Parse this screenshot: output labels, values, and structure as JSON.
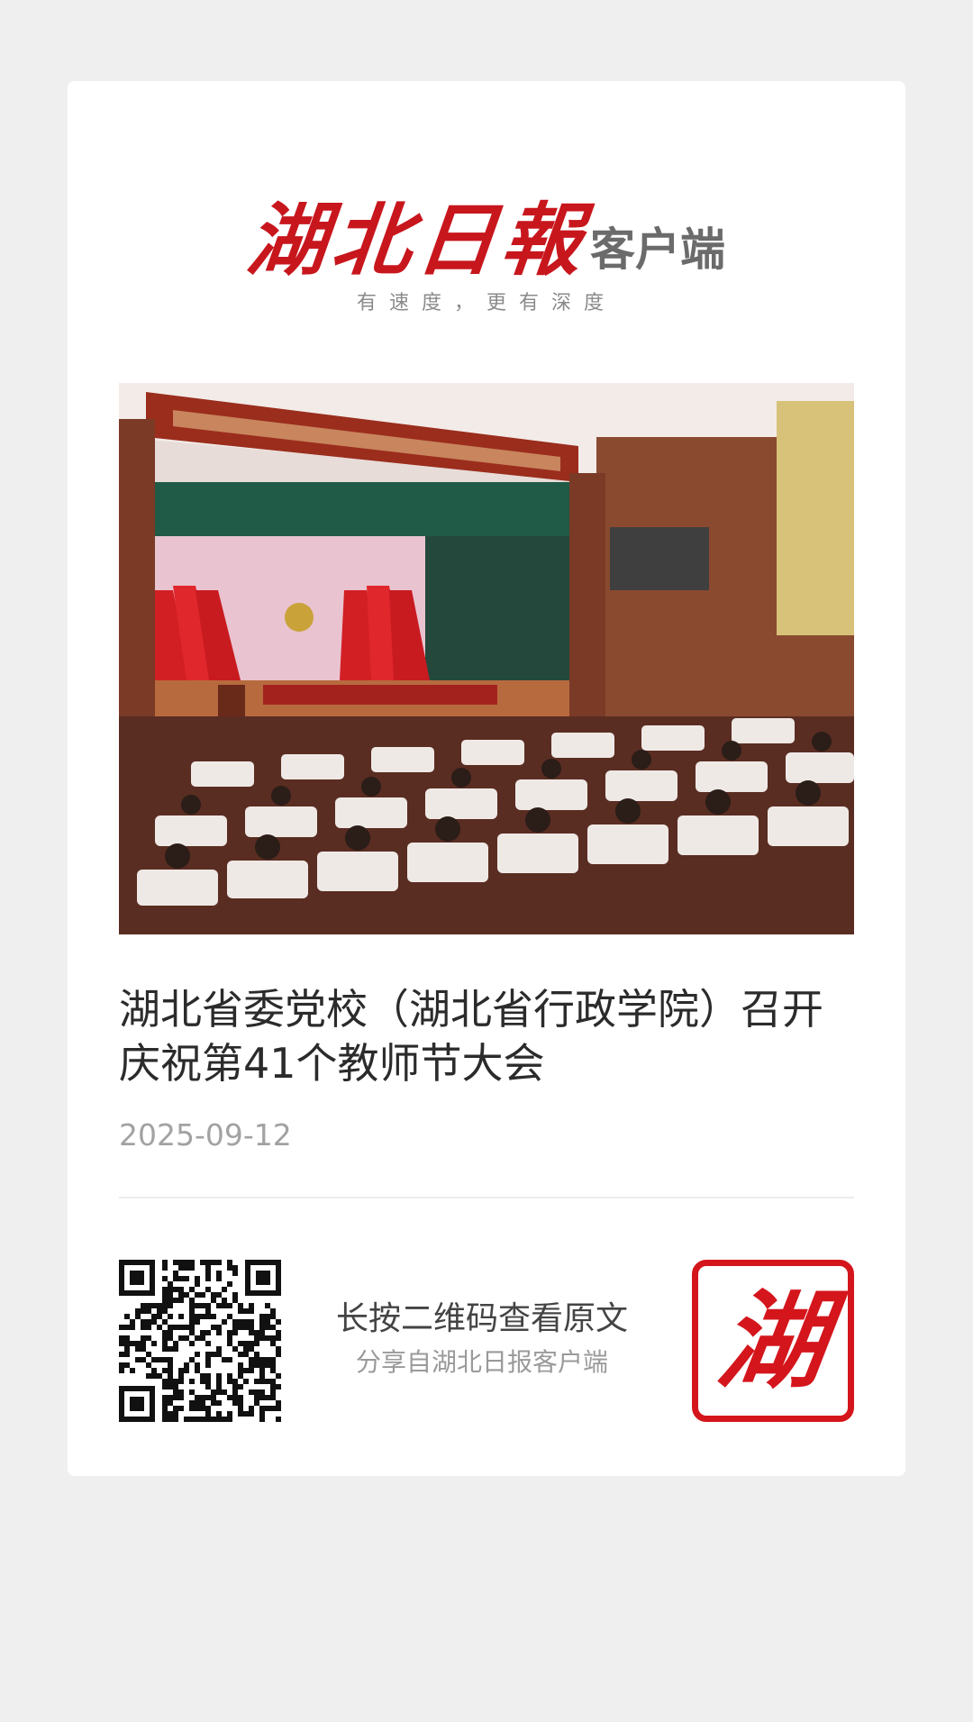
{
  "masthead": {
    "brand_name": "湖北日報",
    "brand_suffix": "客户端",
    "slogan": "有速度，更有深度"
  },
  "article": {
    "title": "湖北省委党校（湖北省行政学院）召开庆祝第41个教师节大会",
    "date": "2025-09-12",
    "image_icon": "photo-conference-hall"
  },
  "share": {
    "cta_main": "长按二维码查看原文",
    "cta_sub": "分享自湖北日报客户端",
    "qr_icon": "qr-code-icon",
    "seal_char": "湖"
  },
  "colors": {
    "brand_red": "#c8161d",
    "seal_red": "#d4161c",
    "background": "#efefef",
    "card": "#ffffff",
    "date_gray": "#a2a2a2"
  }
}
